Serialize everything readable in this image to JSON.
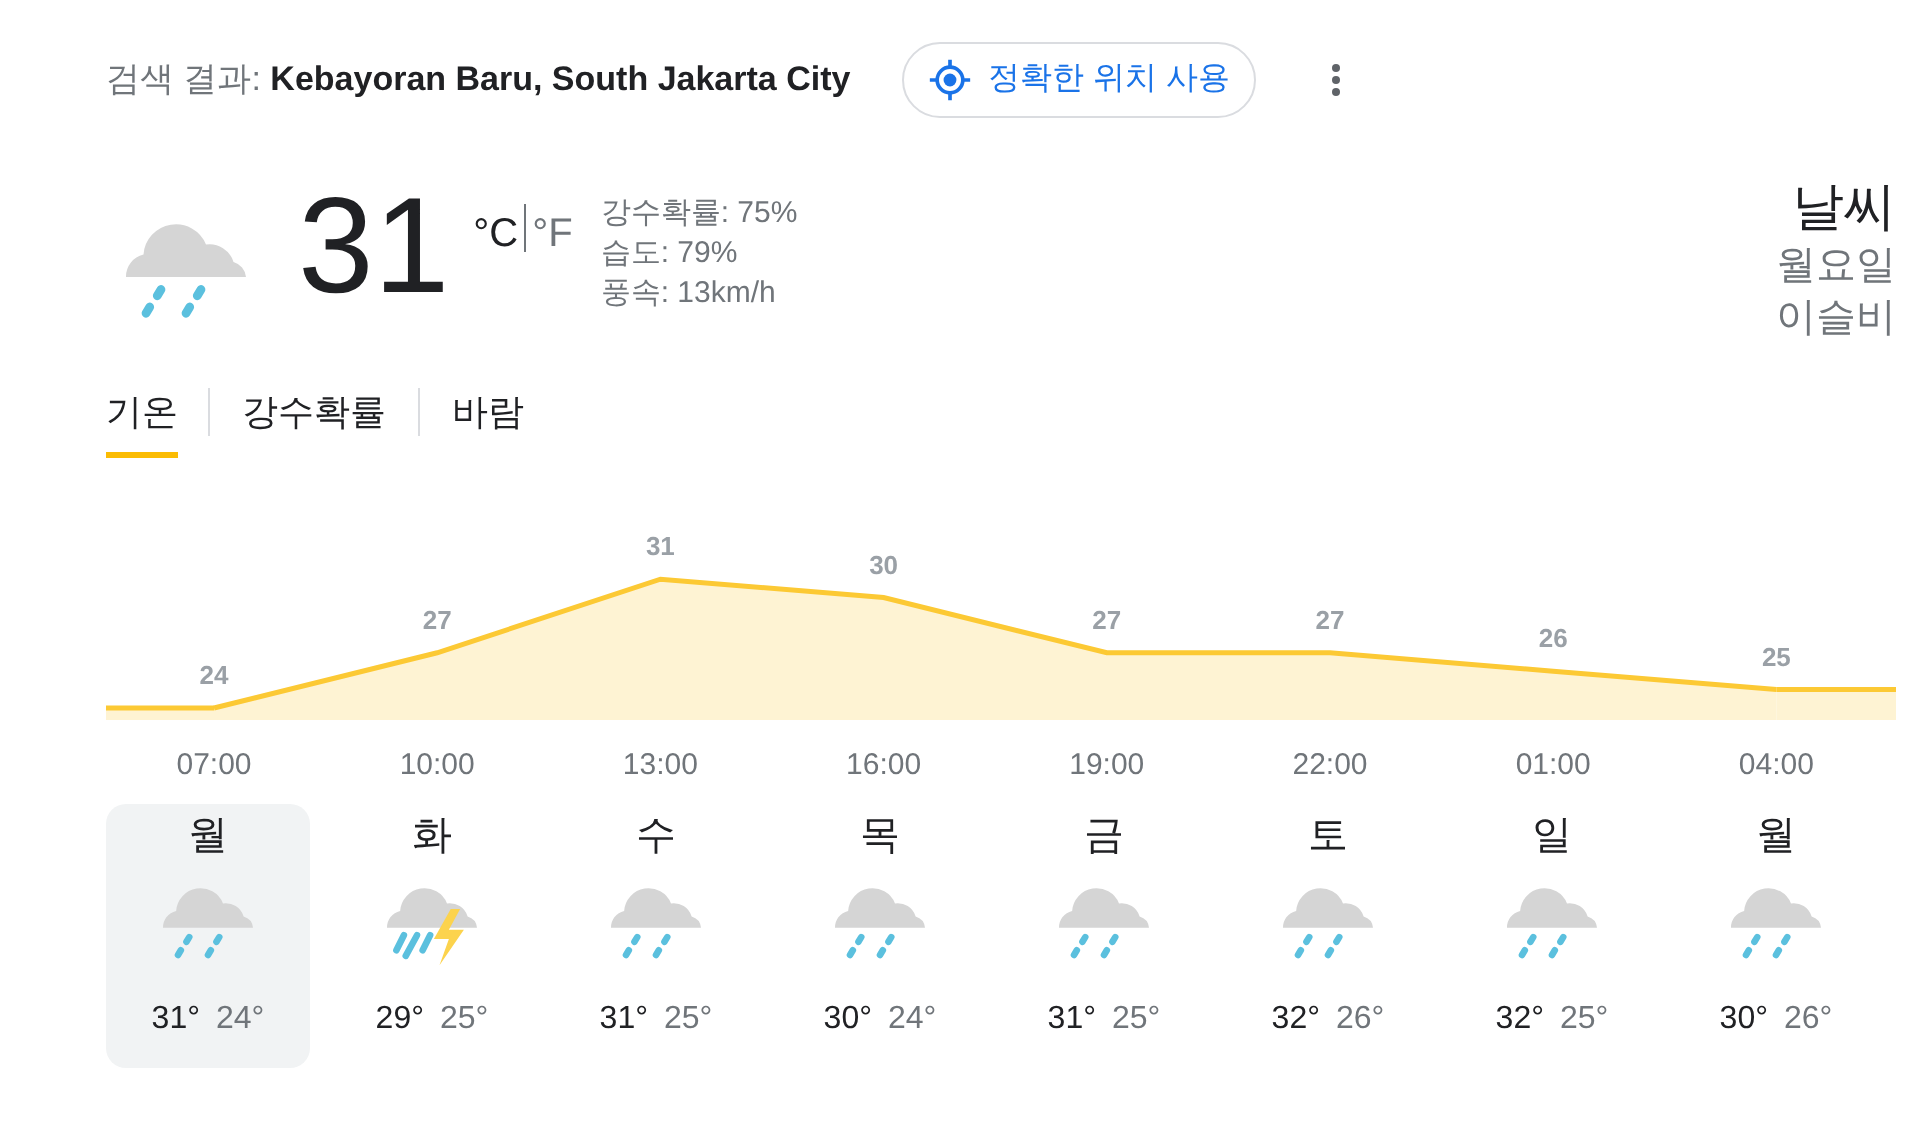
{
  "header": {
    "prefix": "검색 결과:",
    "location": "Kebayoran Baru, South Jakarta City",
    "precise_button": "정확한 위치 사용"
  },
  "current": {
    "kind": "rain",
    "temperature": "31",
    "units": [
      {
        "label": "°C",
        "selected": true
      },
      {
        "label": "°F",
        "selected": false
      }
    ],
    "details": [
      "강수확률: 75%",
      "습도: 79%",
      "풍속: 13km/h"
    ],
    "title": "날씨",
    "day": "월요일",
    "condition": "이슬비"
  },
  "tabs": [
    {
      "label": "기온",
      "selected": true
    },
    {
      "label": "강수확률",
      "selected": false
    },
    {
      "label": "바람",
      "selected": false
    }
  ],
  "chart_data": {
    "type": "area",
    "categories": [
      "07:00",
      "10:00",
      "13:00",
      "16:00",
      "19:00",
      "22:00",
      "01:00",
      "04:00"
    ],
    "series": [
      {
        "color": "#fcc934",
        "values": [
          24,
          27,
          31,
          30,
          27,
          27,
          26,
          25
        ]
      }
    ],
    "data_labels": true
  },
  "days": [
    {
      "day": "월",
      "kind": "rain",
      "high": "31°",
      "low": "24°",
      "selected": true
    },
    {
      "day": "화",
      "kind": "storm",
      "high": "29°",
      "low": "25°",
      "selected": false
    },
    {
      "day": "수",
      "kind": "rain",
      "high": "31°",
      "low": "25°",
      "selected": false
    },
    {
      "day": "목",
      "kind": "rain",
      "high": "30°",
      "low": "24°",
      "selected": false
    },
    {
      "day": "금",
      "kind": "rain",
      "high": "31°",
      "low": "25°",
      "selected": false
    },
    {
      "day": "토",
      "kind": "rain",
      "high": "32°",
      "low": "26°",
      "selected": false
    },
    {
      "day": "일",
      "kind": "rain",
      "high": "32°",
      "low": "25°",
      "selected": false
    },
    {
      "day": "월",
      "kind": "rain",
      "high": "30°",
      "low": "26°",
      "selected": false
    }
  ]
}
